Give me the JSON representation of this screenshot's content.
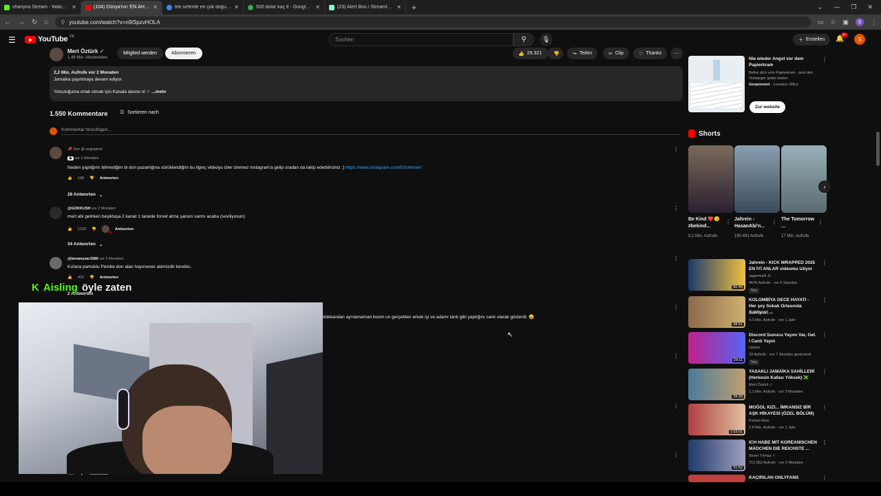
{
  "browser": {
    "tabs": [
      {
        "title": "shanyira Stream - Watch Live o",
        "color": "#53fc18",
        "active": false
      },
      {
        "title": "(104) Dünya'nın 'EN AHLAKSIZ",
        "color": "#ff0000",
        "active": true
      },
      {
        "title": "tek seferde en çok doğum yap",
        "color": "#4285f4",
        "active": false
      },
      {
        "title": "500 dolar kaç tl - Google'da A",
        "color": "#34a853",
        "active": false
      },
      {
        "title": "(23) Alert Box / Streamlabs",
        "color": "#80f5d2",
        "active": false
      }
    ],
    "new_tab": "+",
    "url": "youtube.com/watch?v=n9iSpzvHOLA",
    "profile_initial": "S"
  },
  "youtube": {
    "logo_text": "YouTube",
    "country": "DE",
    "search_placeholder": "Suchen",
    "create_label": "Erstellen",
    "notif_count": "9+",
    "user_initial": "S"
  },
  "video": {
    "channel_name": "Mert Öztürk",
    "subscribers": "1,49 Mio. Abonnenten",
    "join_label": "Mitglied werden",
    "subscribe_label": "Abonnieren",
    "likes": "29.321",
    "share_label": "Teilen",
    "clip_label": "Clip",
    "thanks_label": "Thanks",
    "desc_stats": "2,2 Mio. Aufrufe  vor 2 Monaten",
    "desc_line1": "Jamaika şaşırtmaya devam ediyor.",
    "desc_line2": "Yolculuğuma ortak olmak için Kanala abone ol",
    "more": "...mehr"
  },
  "comments": {
    "count_label": "1.550 Kommentare",
    "sort_label": "Sortieren nach",
    "add_placeholder": "Kommentar hinzufügen...",
    "items": [
      {
        "pinned": "Von @ angepinnt",
        "author": "",
        "time": "vor 2 Monaten",
        "text": "Neden yaptığımı bilmediğim bi don pazarlığına sürüklendiğim bu ilginç videoyu izler izlemez instagram'a gelip oradan da takip edebilirsiniz :) ",
        "link": "https://www.instagram.com/0zturkmert",
        "likes": "198",
        "reply_label": "Antworten",
        "replies": "28 Antworten"
      },
      {
        "author": "@GOKKUSH",
        "time": "vor 2 Monaten",
        "text": "mert abi gelirken beşiktaşa 2 kanat 1 tanede forvet alma şansın varmı acaba (seviliyosun)",
        "likes": "1329",
        "reply_label": "Antworten",
        "replies": "34 Antworten"
      },
      {
        "author": "@kenanuzar1580",
        "time": "vor 2 Monaten",
        "text": "Kızlara pamuklu  Pembe don alan hayırsever abimizdir kendisi..",
        "likes": "402",
        "reply_label": "Antworten",
        "replies": "2 Antworten"
      },
      {
        "text": "dükkandan ayrılamaman boom un gerçekten erkek işi ve adamı tank gibi yaptığını canlı olarak gösterdi. 😄"
      },
      {
        "likes": "138",
        "reply_label": "Antworten"
      }
    ]
  },
  "overlay": {
    "k_icon": "K",
    "name": "Aisling",
    "message": "öyle zaten"
  },
  "sidebar": {
    "ad": {
      "title": "Nie wieder Angst vor dem Papierkram",
      "desc": "Befrei dich vom Papierkram - jetzt den Testsieger gratis testen",
      "sponsored": "Gesponsert",
      "advertiser": "· Lexware Office",
      "cta": "Zur website"
    },
    "shorts_heading": "Shorts",
    "shorts": [
      {
        "title": "Be Kind ❤️😊 #bekind...",
        "views": "9,1 Mio. Aufrufe"
      },
      {
        "title": "Jahrein - HasanAbi'n...",
        "views": "190.491 Aufrufe"
      },
      {
        "title": "The Tomorrow ...",
        "views": "17 Mio. Aufrufe"
      }
    ],
    "videos": [
      {
        "title": "Jahrein - KICK WRAPPED 2025 EN İYİ ANLAR videomu izliyor",
        "channel": "JagermaN Jr.",
        "stats": "4570 Aufrufe · vor 5 Stunden",
        "badge": "Neu",
        "duration": "50:45",
        "bg": "#1b3b6b"
      },
      {
        "title": "KOLOMBİYA GECE HAYATI - Her şey Sokak Ortasında Satılıyor! ...",
        "channel": "Mert Öztürk ✓",
        "stats": "4,3 Mio. Aufrufe · vor 1 Jahr",
        "badge": "",
        "duration": "38:51",
        "bg": "#8a6a4a"
      },
      {
        "title": "Discord Sunucu Yayını Var, Gel. l Canlı Yayın",
        "channel": "Lifanio",
        "stats": "33 Aufrufe · vor 7 Stunden gestreamt",
        "badge": "Neu",
        "duration": "29:11",
        "bg": "#c0208a"
      },
      {
        "title": "YASAKLI JAMAİKA SAHİLLERİ (Herkesin Kafası Yüksek) 🇯🇲",
        "channel": "Mert Öztürk ✓",
        "stats": "1,1 Mio. Aufrufe · vor 3 Monaten",
        "badge": "",
        "duration": "39:39",
        "bg": "#4a7a9a"
      },
      {
        "title": "MOĞOL KIZI... İMKANSIZ BİR AŞK HİKAYESİ (ÖZEL BÖLÜM)",
        "channel": "Furkan Aras",
        "stats": "2,6 Mio. Aufrufe · vor 1 Jahr",
        "badge": "",
        "duration": "1:53:51",
        "bg": "#b04040"
      },
      {
        "title": "ICH HABE MIT KOREANISCHEN MÄDCHEN DIE REICHSTE ...",
        "channel": "Sezer Yılmaz ✓",
        "stats": "712.562 Aufrufe · vor 2 Monaten",
        "badge": "",
        "duration": "51:52",
        "bg": "#203a6a"
      },
      {
        "title": "KAÇIRILAN ONLYFANS",
        "channel": "",
        "stats": "",
        "badge": "",
        "duration": "",
        "bg": "#c04040"
      }
    ]
  },
  "icons": {
    "menu": "hamburger-icon",
    "search": "search-icon",
    "mic": "mic-icon",
    "bell": "bell-icon",
    "like": "thumb-up-icon",
    "dislike": "thumb-down-icon",
    "share": "share-icon",
    "clip": "scissors-icon",
    "thanks": "thanks-icon"
  }
}
